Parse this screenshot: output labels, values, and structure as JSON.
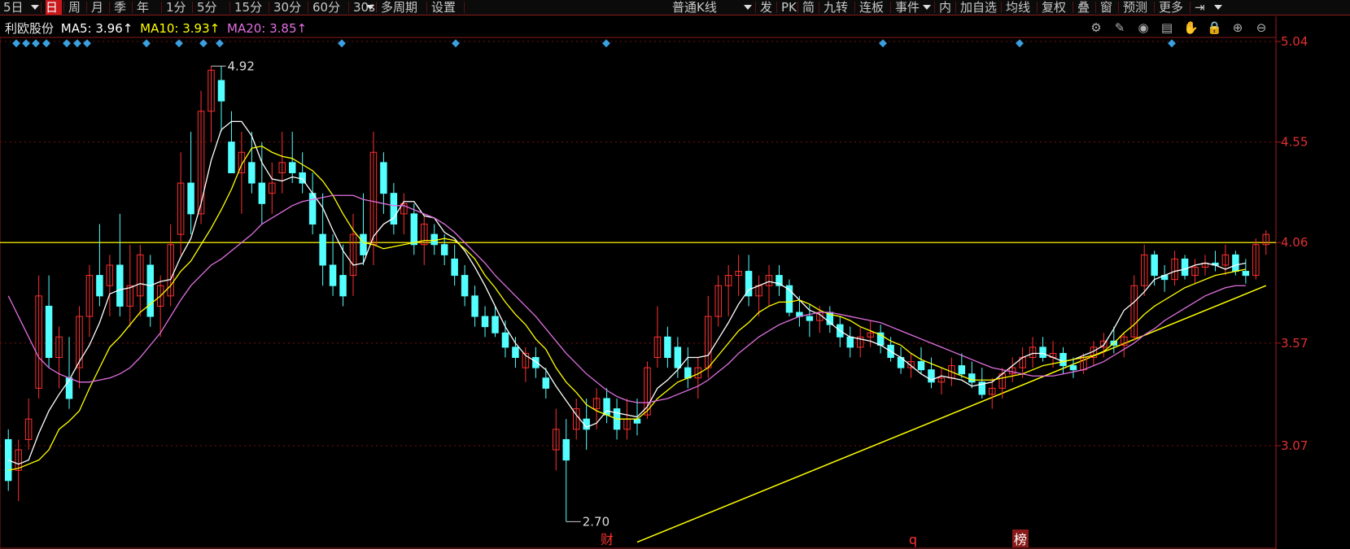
{
  "toolbar": {
    "items": [
      {
        "label": "5日",
        "active": false,
        "dropdown": true
      },
      {
        "label": "日",
        "active": true
      },
      {
        "label": "周"
      },
      {
        "label": "月"
      },
      {
        "label": "季"
      },
      {
        "label": "年"
      },
      {
        "label": "1分"
      },
      {
        "label": "5分"
      },
      {
        "label": "15分"
      },
      {
        "label": "30分"
      },
      {
        "label": "60分"
      },
      {
        "label": "30s",
        "dropdown": true
      },
      {
        "label": "多周期"
      },
      {
        "label": "设置"
      }
    ],
    "right_items": [
      {
        "label": "普通K线",
        "dropdown": true
      },
      {
        "label": "发"
      },
      {
        "label": "PK"
      },
      {
        "label": "简"
      },
      {
        "label": "九转"
      },
      {
        "label": "连板"
      },
      {
        "label": "事件",
        "dropdown": true
      },
      {
        "label": "内"
      },
      {
        "label": "加自选"
      },
      {
        "label": "均线"
      },
      {
        "label": "复权"
      },
      {
        "label": "叠"
      },
      {
        "label": "窗"
      },
      {
        "label": "预测"
      },
      {
        "label": "更多"
      }
    ]
  },
  "stock_name": "利欧股份",
  "ma_labels": [
    {
      "label": "MA5: 3.96↑",
      "color": "#ffffff"
    },
    {
      "label": "MA10: 3.93↑",
      "color": "#ffff00"
    },
    {
      "label": "MA20: 3.85↑",
      "color": "#e070e0"
    }
  ],
  "tool_icons": [
    "settings-icon",
    "pen-icon",
    "eye-icon",
    "box-icon",
    "hand-icon",
    "lock-icon",
    "zoom-in-icon",
    "zoom-out-icon"
  ],
  "markers": {
    "high": "4.92",
    "low": "2.70",
    "events": [
      "财",
      "q",
      "榜"
    ]
  },
  "chart_data": {
    "type": "candlestick",
    "title": "利欧股份",
    "ylim": [
      2.6,
      5.05
    ],
    "y_ticks": [
      "5.04",
      "4.55",
      "4.06",
      "3.57",
      "3.07"
    ],
    "y_tick_values": [
      5.04,
      4.55,
      4.06,
      3.57,
      3.07
    ],
    "horizontal_line": 4.06,
    "ohlc": [
      [
        3.1,
        3.15,
        2.85,
        2.9
      ],
      [
        2.95,
        3.1,
        2.8,
        3.05
      ],
      [
        3.1,
        3.3,
        3.05,
        3.2
      ],
      [
        3.35,
        3.9,
        3.3,
        3.8
      ],
      [
        3.75,
        3.9,
        3.45,
        3.5
      ],
      [
        3.5,
        3.65,
        3.35,
        3.6
      ],
      [
        3.4,
        3.6,
        3.25,
        3.3
      ],
      [
        3.45,
        3.75,
        3.35,
        3.7
      ],
      [
        3.7,
        3.95,
        3.6,
        3.9
      ],
      [
        3.9,
        4.15,
        3.75,
        3.8
      ],
      [
        3.85,
        4.0,
        3.7,
        3.95
      ],
      [
        3.95,
        4.2,
        3.7,
        3.75
      ],
      [
        3.75,
        4.05,
        3.65,
        3.85
      ],
      [
        3.8,
        4.05,
        3.7,
        4.0
      ],
      [
        3.95,
        4.0,
        3.65,
        3.7
      ],
      [
        3.75,
        3.9,
        3.6,
        3.85
      ],
      [
        3.8,
        4.15,
        3.75,
        4.05
      ],
      [
        4.1,
        4.5,
        4.0,
        4.35
      ],
      [
        4.35,
        4.6,
        4.1,
        4.2
      ],
      [
        4.2,
        4.8,
        4.15,
        4.7
      ],
      [
        4.7,
        4.92,
        4.55,
        4.9
      ],
      [
        4.85,
        4.92,
        4.6,
        4.75
      ],
      [
        4.55,
        4.7,
        4.4,
        4.4
      ],
      [
        4.4,
        4.6,
        4.2,
        4.5
      ],
      [
        4.45,
        4.6,
        4.3,
        4.35
      ],
      [
        4.35,
        4.55,
        4.15,
        4.25
      ],
      [
        4.3,
        4.45,
        4.2,
        4.35
      ],
      [
        4.4,
        4.6,
        4.3,
        4.45
      ],
      [
        4.45,
        4.6,
        4.35,
        4.4
      ],
      [
        4.4,
        4.5,
        4.3,
        4.35
      ],
      [
        4.3,
        4.4,
        4.1,
        4.15
      ],
      [
        4.1,
        4.3,
        3.85,
        3.95
      ],
      [
        3.95,
        4.1,
        3.8,
        3.85
      ],
      [
        3.9,
        4.05,
        3.75,
        3.8
      ],
      [
        3.9,
        4.2,
        3.8,
        4.1
      ],
      [
        4.1,
        4.3,
        3.95,
        4.0
      ],
      [
        4.05,
        4.6,
        3.95,
        4.5
      ],
      [
        4.45,
        4.5,
        4.2,
        4.3
      ],
      [
        4.3,
        4.35,
        4.1,
        4.15
      ],
      [
        4.2,
        4.3,
        4.1,
        4.25
      ],
      [
        4.2,
        4.25,
        4.0,
        4.05
      ],
      [
        4.05,
        4.2,
        3.95,
        4.15
      ],
      [
        4.1,
        4.15,
        4.0,
        4.05
      ],
      [
        4.05,
        4.1,
        3.95,
        4.0
      ],
      [
        3.98,
        4.05,
        3.85,
        3.9
      ],
      [
        3.9,
        3.95,
        3.75,
        3.8
      ],
      [
        3.8,
        3.85,
        3.65,
        3.7
      ],
      [
        3.7,
        3.75,
        3.6,
        3.65
      ],
      [
        3.7,
        3.75,
        3.6,
        3.62
      ],
      [
        3.62,
        3.68,
        3.5,
        3.55
      ],
      [
        3.55,
        3.6,
        3.45,
        3.5
      ],
      [
        3.45,
        3.55,
        3.38,
        3.52
      ],
      [
        3.5,
        3.55,
        3.4,
        3.45
      ],
      [
        3.4,
        3.45,
        3.3,
        3.35
      ],
      [
        3.05,
        3.25,
        2.95,
        3.15
      ],
      [
        3.1,
        3.2,
        2.7,
        3.0
      ],
      [
        3.15,
        3.3,
        3.1,
        3.25
      ],
      [
        3.2,
        3.3,
        3.05,
        3.15
      ],
      [
        3.25,
        3.35,
        3.15,
        3.3
      ],
      [
        3.3,
        3.35,
        3.18,
        3.22
      ],
      [
        3.25,
        3.3,
        3.1,
        3.15
      ],
      [
        3.15,
        3.3,
        3.1,
        3.2
      ],
      [
        3.2,
        3.3,
        3.12,
        3.18
      ],
      [
        3.22,
        3.48,
        3.2,
        3.45
      ],
      [
        3.5,
        3.75,
        3.45,
        3.6
      ],
      [
        3.6,
        3.65,
        3.45,
        3.5
      ],
      [
        3.55,
        3.6,
        3.4,
        3.45
      ],
      [
        3.45,
        3.55,
        3.35,
        3.4
      ],
      [
        3.4,
        3.5,
        3.3,
        3.45
      ],
      [
        3.45,
        3.8,
        3.4,
        3.7
      ],
      [
        3.7,
        3.9,
        3.65,
        3.85
      ],
      [
        3.85,
        3.95,
        3.7,
        3.9
      ],
      [
        3.9,
        4.0,
        3.8,
        3.92
      ],
      [
        3.92,
        4.0,
        3.75,
        3.8
      ],
      [
        3.8,
        3.9,
        3.7,
        3.85
      ],
      [
        3.85,
        3.95,
        3.75,
        3.9
      ],
      [
        3.9,
        3.95,
        3.8,
        3.85
      ],
      [
        3.85,
        3.88,
        3.7,
        3.72
      ],
      [
        3.72,
        3.8,
        3.65,
        3.7
      ],
      [
        3.7,
        3.76,
        3.6,
        3.68
      ],
      [
        3.68,
        3.75,
        3.62,
        3.72
      ],
      [
        3.72,
        3.75,
        3.62,
        3.66
      ],
      [
        3.66,
        3.7,
        3.55,
        3.6
      ],
      [
        3.6,
        3.65,
        3.5,
        3.55
      ],
      [
        3.55,
        3.65,
        3.5,
        3.6
      ],
      [
        3.6,
        3.68,
        3.55,
        3.62
      ],
      [
        3.62,
        3.66,
        3.52,
        3.56
      ],
      [
        3.56,
        3.6,
        3.48,
        3.5
      ],
      [
        3.5,
        3.55,
        3.42,
        3.45
      ],
      [
        3.45,
        3.52,
        3.4,
        3.48
      ],
      [
        3.48,
        3.55,
        3.42,
        3.44
      ],
      [
        3.44,
        3.5,
        3.35,
        3.38
      ],
      [
        3.38,
        3.45,
        3.32,
        3.4
      ],
      [
        3.4,
        3.5,
        3.36,
        3.46
      ],
      [
        3.46,
        3.52,
        3.4,
        3.42
      ],
      [
        3.42,
        3.48,
        3.35,
        3.38
      ],
      [
        3.38,
        3.45,
        3.3,
        3.32
      ],
      [
        3.32,
        3.4,
        3.25,
        3.35
      ],
      [
        3.35,
        3.45,
        3.3,
        3.42
      ],
      [
        3.42,
        3.5,
        3.38,
        3.45
      ],
      [
        3.45,
        3.55,
        3.4,
        3.5
      ],
      [
        3.5,
        3.6,
        3.45,
        3.55
      ],
      [
        3.55,
        3.6,
        3.48,
        3.5
      ],
      [
        3.5,
        3.58,
        3.45,
        3.52
      ],
      [
        3.52,
        3.55,
        3.42,
        3.46
      ],
      [
        3.46,
        3.5,
        3.4,
        3.44
      ],
      [
        3.44,
        3.52,
        3.42,
        3.5
      ],
      [
        3.5,
        3.58,
        3.46,
        3.55
      ],
      [
        3.55,
        3.62,
        3.5,
        3.58
      ],
      [
        3.58,
        3.65,
        3.52,
        3.56
      ],
      [
        3.56,
        3.62,
        3.5,
        3.6
      ],
      [
        3.6,
        3.9,
        3.58,
        3.85
      ],
      [
        3.85,
        4.05,
        3.8,
        4.0
      ],
      [
        4.0,
        4.02,
        3.85,
        3.9
      ],
      [
        3.9,
        3.95,
        3.82,
        3.88
      ],
      [
        3.88,
        4.02,
        3.85,
        3.98
      ],
      [
        3.98,
        4.0,
        3.88,
        3.9
      ],
      [
        3.9,
        3.98,
        3.86,
        3.94
      ],
      [
        3.94,
        4.0,
        3.9,
        3.96
      ],
      [
        3.96,
        4.02,
        3.92,
        3.95
      ],
      [
        3.95,
        4.05,
        3.9,
        4.0
      ],
      [
        4.0,
        4.02,
        3.9,
        3.92
      ],
      [
        3.92,
        3.98,
        3.86,
        3.9
      ],
      [
        3.9,
        4.08,
        3.88,
        4.05
      ],
      [
        4.05,
        4.12,
        4.0,
        4.1
      ]
    ],
    "series": [
      {
        "name": "MA5",
        "color": "#ffffff",
        "values": [
          3.0,
          2.98,
          3.0,
          3.13,
          3.24,
          3.32,
          3.39,
          3.48,
          3.56,
          3.67,
          3.81,
          3.83,
          3.84,
          3.86,
          3.85,
          3.87,
          3.88,
          3.99,
          4.08,
          4.25,
          4.46,
          4.61,
          4.65,
          4.65,
          4.58,
          4.45,
          4.37,
          4.36,
          4.38,
          4.37,
          4.3,
          4.23,
          4.12,
          4.02,
          3.95,
          3.96,
          4.09,
          4.15,
          4.18,
          4.26,
          4.26,
          4.19,
          4.18,
          4.11,
          4.08,
          4.02,
          3.94,
          3.85,
          3.75,
          3.65,
          3.57,
          3.51,
          3.48,
          3.44,
          3.36,
          3.29,
          3.22,
          3.16,
          3.18,
          3.24,
          3.23,
          3.22,
          3.21,
          3.26,
          3.35,
          3.39,
          3.44,
          3.5,
          3.5,
          3.51,
          3.59,
          3.67,
          3.76,
          3.83,
          3.85,
          3.87,
          3.86,
          3.83,
          3.78,
          3.73,
          3.71,
          3.67,
          3.63,
          3.6,
          3.59,
          3.58,
          3.56,
          3.53,
          3.5,
          3.46,
          3.42,
          3.39,
          3.41,
          3.4,
          3.39,
          3.36,
          3.37,
          3.38,
          3.42,
          3.46,
          3.5,
          3.52,
          3.52,
          3.5,
          3.48,
          3.49,
          3.51,
          3.53,
          3.56,
          3.64,
          3.73,
          3.77,
          3.82,
          3.88,
          3.9,
          3.92,
          3.93,
          3.95,
          3.96,
          3.95,
          3.93,
          3.95,
          3.96
        ]
      },
      {
        "name": "MA10",
        "color": "#ffff00",
        "values": [
          2.95,
          2.96,
          2.98,
          3.0,
          3.05,
          3.15,
          3.19,
          3.24,
          3.35,
          3.45,
          3.55,
          3.6,
          3.66,
          3.72,
          3.76,
          3.8,
          3.85,
          3.92,
          3.97,
          4.05,
          4.13,
          4.22,
          4.32,
          4.44,
          4.52,
          4.53,
          4.5,
          4.48,
          4.47,
          4.44,
          4.41,
          4.36,
          4.29,
          4.2,
          4.12,
          4.06,
          4.05,
          4.03,
          4.04,
          4.05,
          4.06,
          4.07,
          4.07,
          4.08,
          4.07,
          4.03,
          3.98,
          3.9,
          3.84,
          3.77,
          3.71,
          3.66,
          3.59,
          3.54,
          3.45,
          3.38,
          3.33,
          3.27,
          3.24,
          3.22,
          3.2,
          3.2,
          3.2,
          3.24,
          3.3,
          3.34,
          3.38,
          3.4,
          3.42,
          3.45,
          3.51,
          3.57,
          3.63,
          3.67,
          3.72,
          3.75,
          3.77,
          3.77,
          3.78,
          3.76,
          3.73,
          3.71,
          3.7,
          3.68,
          3.65,
          3.63,
          3.61,
          3.58,
          3.56,
          3.52,
          3.49,
          3.47,
          3.45,
          3.43,
          3.41,
          3.39,
          3.39,
          3.39,
          3.4,
          3.41,
          3.42,
          3.44,
          3.46,
          3.47,
          3.48,
          3.49,
          3.5,
          3.51,
          3.53,
          3.57,
          3.62,
          3.66,
          3.71,
          3.75,
          3.78,
          3.81,
          3.84,
          3.86,
          3.88,
          3.9,
          3.91,
          3.92,
          3.93
        ]
      },
      {
        "name": "MA20",
        "color": "#e070e0",
        "values": [
          3.8,
          3.7,
          3.6,
          3.5,
          3.45,
          3.42,
          3.4,
          3.38,
          3.38,
          3.39,
          3.4,
          3.42,
          3.45,
          3.5,
          3.56,
          3.62,
          3.7,
          3.78,
          3.85,
          3.9,
          3.95,
          3.98,
          4.02,
          4.06,
          4.1,
          4.15,
          4.18,
          4.21,
          4.24,
          4.26,
          4.27,
          4.28,
          4.29,
          4.29,
          4.29,
          4.27,
          4.26,
          4.25,
          4.24,
          4.24,
          4.22,
          4.2,
          4.18,
          4.15,
          4.11,
          4.06,
          4.01,
          3.96,
          3.9,
          3.85,
          3.8,
          3.75,
          3.7,
          3.64,
          3.58,
          3.52,
          3.47,
          3.42,
          3.38,
          3.34,
          3.31,
          3.29,
          3.28,
          3.28,
          3.29,
          3.3,
          3.32,
          3.34,
          3.36,
          3.39,
          3.43,
          3.47,
          3.52,
          3.56,
          3.6,
          3.63,
          3.66,
          3.68,
          3.7,
          3.71,
          3.72,
          3.72,
          3.71,
          3.7,
          3.69,
          3.68,
          3.67,
          3.65,
          3.63,
          3.61,
          3.59,
          3.57,
          3.55,
          3.53,
          3.51,
          3.49,
          3.47,
          3.45,
          3.44,
          3.43,
          3.42,
          3.41,
          3.41,
          3.41,
          3.42,
          3.43,
          3.44,
          3.46,
          3.48,
          3.51,
          3.54,
          3.57,
          3.61,
          3.64,
          3.68,
          3.71,
          3.74,
          3.77,
          3.8,
          3.82,
          3.84,
          3.85,
          3.85
        ]
      }
    ],
    "trendline": {
      "from": [
        62,
        2.6
      ],
      "to": [
        124,
        3.85
      ],
      "color": "#ffff00"
    }
  }
}
